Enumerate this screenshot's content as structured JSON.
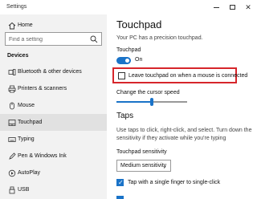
{
  "window": {
    "title": "Settings",
    "controls": {
      "minimize": "minimize-icon",
      "maximize": "maximize-icon",
      "close": "close-icon"
    }
  },
  "sidebar": {
    "home_label": "Home",
    "search_placeholder": "Find a setting",
    "section_title": "Devices",
    "items": [
      {
        "label": "Bluetooth & other devices",
        "icon": "bluetooth-icon"
      },
      {
        "label": "Printers & scanners",
        "icon": "printer-icon"
      },
      {
        "label": "Mouse",
        "icon": "mouse-icon"
      },
      {
        "label": "Touchpad",
        "icon": "touchpad-icon",
        "selected": true
      },
      {
        "label": "Typing",
        "icon": "keyboard-icon"
      },
      {
        "label": "Pen & Windows Ink",
        "icon": "pen-icon"
      },
      {
        "label": "AutoPlay",
        "icon": "autoplay-icon"
      },
      {
        "label": "USB",
        "icon": "usb-icon"
      }
    ]
  },
  "content": {
    "title": "Touchpad",
    "subtitle": "Your PC has a precision touchpad.",
    "touchpad_label": "Touchpad",
    "toggle_state": "On",
    "toggle_on": true,
    "leave_touchpad_label": "Leave touchpad on when a mouse is connected",
    "leave_touchpad_checked": false,
    "cursor_speed_label": "Change the cursor speed",
    "cursor_speed_fraction": 0.5,
    "taps_heading": "Taps",
    "taps_description": "Use taps to click, right-click, and select. Turn down the sensitivity if they activate while you're typing",
    "sensitivity_label": "Touchpad sensitivity",
    "sensitivity_value": "Medium sensitivity",
    "tap_single_label": "Tap with a single finger to single-click",
    "tap_single_checked": true
  },
  "colors": {
    "accent": "#1a73c8",
    "highlight_outline": "#d6262b",
    "sidebar_bg": "#f2f2f2"
  }
}
